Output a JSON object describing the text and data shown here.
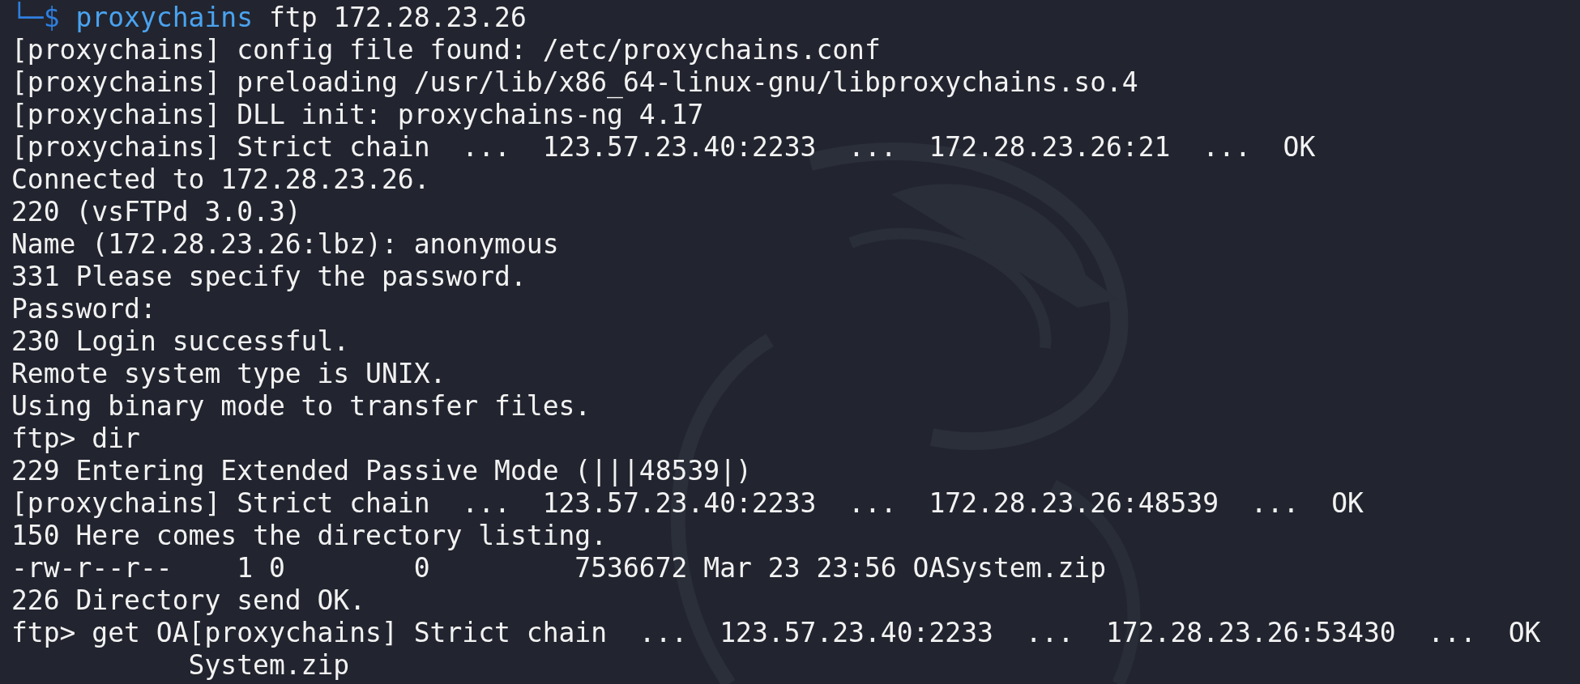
{
  "terminal": {
    "lines": [
      {
        "kind": "prompt",
        "prompt": "└─$",
        "command": "proxychains",
        "args": "ftp 172.28.23.26"
      },
      {
        "kind": "output",
        "text": "[proxychains] config file found: /etc/proxychains.conf"
      },
      {
        "kind": "output",
        "text": "[proxychains] preloading /usr/lib/x86_64-linux-gnu/libproxychains.so.4"
      },
      {
        "kind": "output",
        "text": "[proxychains] DLL init: proxychains-ng 4.17"
      },
      {
        "kind": "output",
        "text": "[proxychains] Strict chain  ...  123.57.23.40:2233  ...  172.28.23.26:21  ...  OK"
      },
      {
        "kind": "output",
        "text": "Connected to 172.28.23.26."
      },
      {
        "kind": "output",
        "text": "220 (vsFTPd 3.0.3)"
      },
      {
        "kind": "output",
        "text": "Name (172.28.23.26:lbz): anonymous"
      },
      {
        "kind": "output",
        "text": "331 Please specify the password."
      },
      {
        "kind": "output",
        "text": "Password:"
      },
      {
        "kind": "output",
        "text": "230 Login successful."
      },
      {
        "kind": "output",
        "text": "Remote system type is UNIX."
      },
      {
        "kind": "output",
        "text": "Using binary mode to transfer files."
      },
      {
        "kind": "output",
        "text": "ftp> dir"
      },
      {
        "kind": "output",
        "text": "229 Entering Extended Passive Mode (|||48539|)"
      },
      {
        "kind": "output",
        "text": "[proxychains] Strict chain  ...  123.57.23.40:2233  ...  172.28.23.26:48539  ...  OK"
      },
      {
        "kind": "output",
        "text": "150 Here comes the directory listing."
      },
      {
        "kind": "output",
        "text": "-rw-r--r--    1 0        0         7536672 Mar 23 23:56 OASystem.zip"
      },
      {
        "kind": "output",
        "text": "226 Directory send OK."
      },
      {
        "kind": "output",
        "text": "ftp> get OA[proxychains] Strict chain  ...  123.57.23.40:2233  ...  172.28.23.26:53430  ...  OK"
      },
      {
        "kind": "output",
        "text": "           System.zip"
      }
    ]
  }
}
